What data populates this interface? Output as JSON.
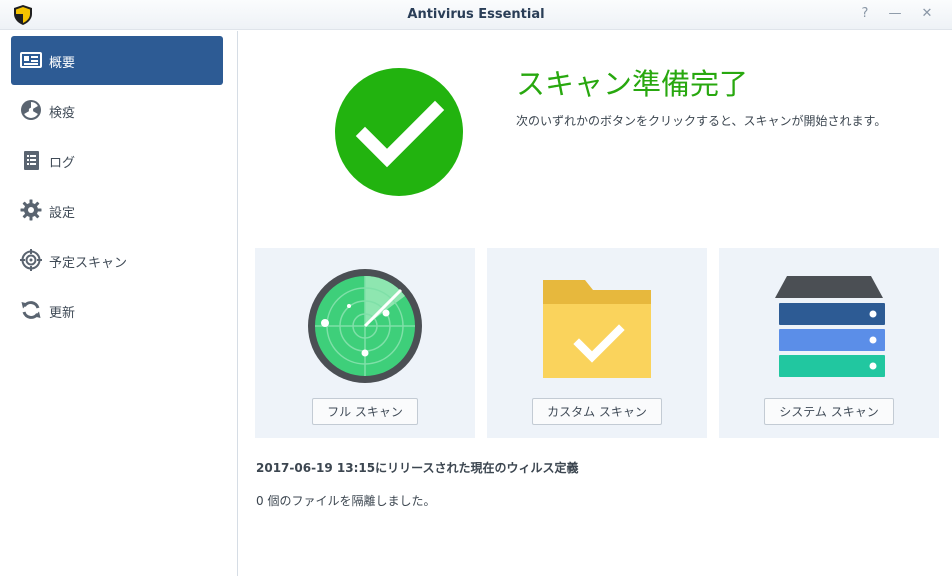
{
  "window": {
    "title": "Antivirus Essential",
    "help_glyph": "?",
    "minimize_glyph": "—",
    "close_glyph": "✕"
  },
  "sidebar": {
    "items": [
      {
        "label": "概要",
        "icon": "overview-card-icon",
        "active": true
      },
      {
        "label": "検疫",
        "icon": "radiation-icon",
        "active": false
      },
      {
        "label": "ログ",
        "icon": "log-list-icon",
        "active": false
      },
      {
        "label": "設定",
        "icon": "gear-icon",
        "active": false
      },
      {
        "label": "予定スキャン",
        "icon": "target-icon",
        "active": false
      },
      {
        "label": "更新",
        "icon": "refresh-icon",
        "active": false
      }
    ]
  },
  "status": {
    "title": "スキャン準備完了",
    "description": "次のいずれかのボタンをクリックすると、スキャンが開始されます。",
    "icon": "checkmark-circle-icon"
  },
  "scans": {
    "full": {
      "label": "フル スキャン",
      "icon": "radar-icon"
    },
    "custom": {
      "label": "カスタム スキャン",
      "icon": "folder-check-icon"
    },
    "system": {
      "label": "システム スキャン",
      "icon": "server-stack-icon"
    }
  },
  "info": {
    "definitions": "2017-06-19 13:15にリリースされた現在のウィルス定義",
    "quarantine": "0 個のファイルを隔離しました。"
  },
  "colors": {
    "accent": "#2d5b94",
    "success": "#22b30f",
    "card_bg": "#eef3f9"
  }
}
